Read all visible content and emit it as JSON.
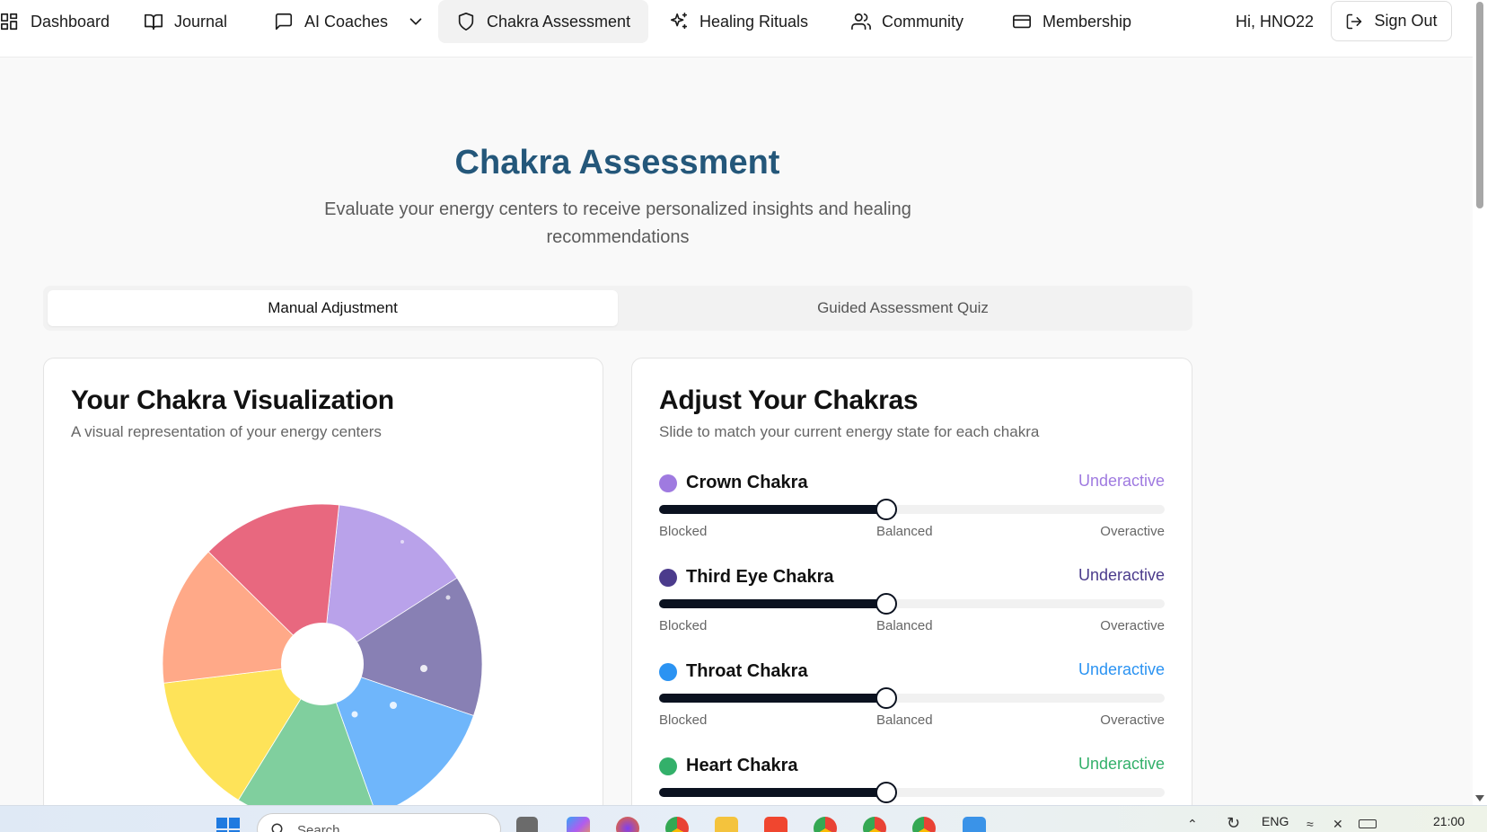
{
  "nav": {
    "items": [
      {
        "label": "Dashboard",
        "icon": "dashboard-grid-icon"
      },
      {
        "label": "Journal",
        "icon": "book-open-icon"
      },
      {
        "label": "AI Coaches",
        "icon": "message-square-icon"
      },
      {
        "label": "Chakra Assessment",
        "icon": "shield-icon"
      },
      {
        "label": "Healing Rituals",
        "icon": "sparkles-icon"
      },
      {
        "label": "Community",
        "icon": "users-icon"
      },
      {
        "label": "Membership",
        "icon": "credit-card-icon"
      }
    ],
    "active": "Chakra Assessment",
    "greeting": "Hi, HNO22",
    "signout_label": "Sign Out"
  },
  "hero": {
    "title": "Chakra Assessment",
    "subtitle": "Evaluate your energy centers to receive personalized insights and healing recommendations"
  },
  "tabs": [
    {
      "label": "Manual Adjustment",
      "active": true
    },
    {
      "label": "Guided Assessment Quiz",
      "active": false
    }
  ],
  "visualization": {
    "title": "Your Chakra Visualization",
    "description": "A visual representation of your energy centers",
    "segments": [
      {
        "color": "#b9a2ea"
      },
      {
        "color": "#8880b4"
      },
      {
        "color": "#6fb6fb"
      },
      {
        "color": "#80cf9e"
      },
      {
        "color": "#fee359"
      },
      {
        "color": "#ffa988"
      },
      {
        "color": "#e8687f"
      }
    ]
  },
  "adjust": {
    "title": "Adjust Your Chakras",
    "description": "Slide to match your current energy state for each chakra",
    "scale": {
      "low": "Blocked",
      "mid": "Balanced",
      "high": "Overactive"
    },
    "chakras": [
      {
        "name": "Crown Chakra",
        "status": "Underactive",
        "color": "#9f7ae0",
        "value": 45
      },
      {
        "name": "Third Eye Chakra",
        "status": "Underactive",
        "color": "#4b3b8c",
        "value": 45
      },
      {
        "name": "Throat Chakra",
        "status": "Underactive",
        "color": "#2b93f2",
        "value": 45
      },
      {
        "name": "Heart Chakra",
        "status": "Underactive",
        "color": "#33b06a",
        "value": 45
      }
    ]
  },
  "taskbar": {
    "search_placeholder": "Search",
    "language": "ENG",
    "time": "21:00"
  }
}
